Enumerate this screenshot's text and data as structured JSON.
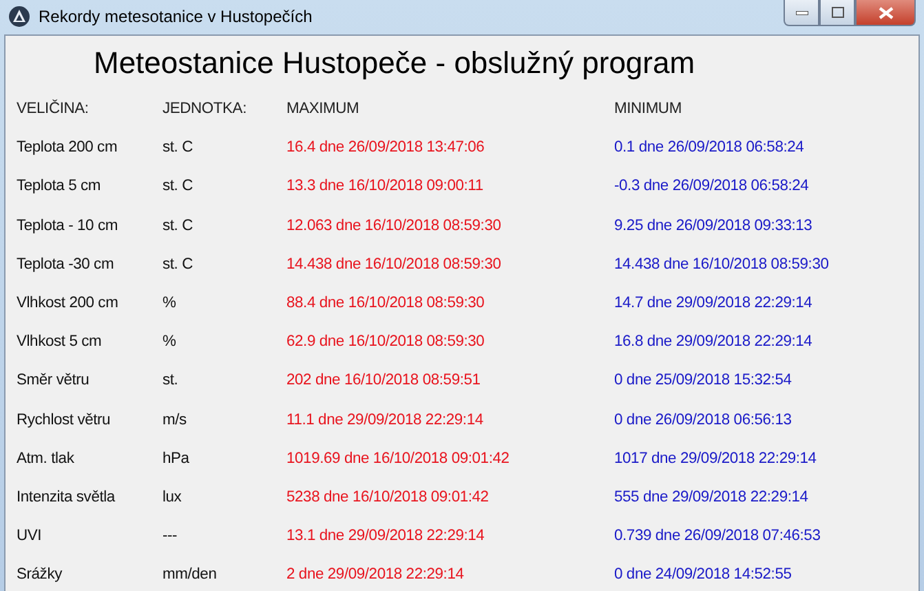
{
  "window": {
    "title": "Rekordy metesotanice v Hustopečích"
  },
  "heading": "Meteostanice Hustopeče - obslužný program",
  "columns": [
    "VELIČINA:",
    "JEDNOTKA:",
    "MAXIMUM",
    "MINIMUM"
  ],
  "rows": [
    {
      "name": "Teplota 200 cm",
      "unit": "st. C",
      "max": "16.4 dne 26/09/2018 13:47:06",
      "min": "0.1 dne 26/09/2018 06:58:24"
    },
    {
      "name": "Teplota 5 cm",
      "unit": "st. C",
      "max": "13.3 dne 16/10/2018 09:00:11",
      "min": "-0.3 dne 26/09/2018 06:58:24"
    },
    {
      "name": "Teplota - 10 cm",
      "unit": "st. C",
      "max": "12.063 dne 16/10/2018 08:59:30",
      "min": "9.25 dne 26/09/2018 09:33:13"
    },
    {
      "name": "Teplota -30 cm",
      "unit": "st. C",
      "max": "14.438 dne 16/10/2018 08:59:30",
      "min": "14.438 dne 16/10/2018 08:59:30"
    },
    {
      "name": "Vlhkost 200 cm",
      "unit": "%",
      "max": "88.4 dne 16/10/2018 08:59:30",
      "min": "14.7 dne 29/09/2018 22:29:14"
    },
    {
      "name": "Vlhkost 5 cm",
      "unit": "%",
      "max": "62.9 dne 16/10/2018 08:59:30",
      "min": "16.8 dne 29/09/2018 22:29:14"
    },
    {
      "name": "Směr větru",
      "unit": "st.",
      "max": "202 dne 16/10/2018 08:59:51",
      "min": "0 dne 25/09/2018 15:32:54"
    },
    {
      "name": "Rychlost větru",
      "unit": "m/s",
      "max": "11.1 dne 29/09/2018 22:29:14",
      "min": "0 dne 26/09/2018 06:56:13"
    },
    {
      "name": "Atm. tlak",
      "unit": "hPa",
      "max": "1019.69 dne 16/10/2018 09:01:42",
      "min": "1017 dne 29/09/2018 22:29:14"
    },
    {
      "name": "Intenzita světla",
      "unit": "lux",
      "max": "5238 dne 16/10/2018 09:01:42",
      "min": "555 dne 29/09/2018 22:29:14"
    },
    {
      "name": "UVI",
      "unit": "---",
      "max": "13.1 dne 29/09/2018 22:29:14",
      "min": "0.739 dne 26/09/2018 07:46:53"
    },
    {
      "name": "Srážky",
      "unit": "mm/den",
      "max": "2 dne 29/09/2018 22:29:14",
      "min": "0 dne 24/09/2018 14:52:55"
    }
  ]
}
